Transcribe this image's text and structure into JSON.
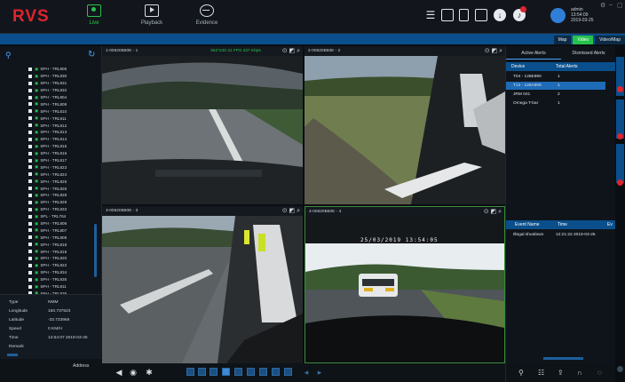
{
  "app": {
    "logo": "RVS"
  },
  "nav": [
    {
      "label": "Live",
      "icon": "live-monitor-icon",
      "active": true
    },
    {
      "label": "Playback",
      "icon": "playback-icon",
      "active": false
    },
    {
      "label": "Evidence",
      "icon": "evidence-icon",
      "active": false
    }
  ],
  "user": {
    "name": "admin",
    "time": "13:54:09",
    "date": "2019-03-25"
  },
  "right_tabs": [
    {
      "label": "Map",
      "active": false
    },
    {
      "label": "Video",
      "active": true
    },
    {
      "label": "Video/Map",
      "active": false
    }
  ],
  "devices": [
    "SPH - TRL805",
    "SPH - TRL830",
    "SPH - TRL831",
    "SPH - TRL832",
    "SPH - TRL804",
    "SPH - TRL809",
    "SPH - TRL810",
    "SPH - TRL811",
    "SPH - TRL812",
    "SPH - TRL813",
    "SPH - TRL814",
    "SPH - TRL815",
    "SPH - TRL816",
    "SPH - TRL817",
    "SPH - TRL823",
    "SPH - TRL824",
    "SPH - TRL825",
    "SPH - TRL826",
    "SPH - TRL828",
    "SPH - TRL829",
    "SPH - TRL833",
    "SPL - TRL764",
    "SPH - TRL806",
    "SPH - TRL807",
    "SPH - TRL808",
    "SPH - TRL818",
    "SPH - TRL819",
    "SPH - TRL820",
    "SPH - TRL822",
    "SPH - TRL834",
    "SPH - TRL835",
    "SPH - TRL811",
    "SPH - TRL836"
  ],
  "gps": {
    "type_label": "Type",
    "type": "NMM",
    "longitude_label": "Longitude",
    "longitude": "150.737523",
    "latitude_label": "Latitude",
    "latitude": "-33.733968",
    "speed_label": "Speed",
    "speed": "0 KM/H",
    "time_label": "Time",
    "time": "13:54:07 2019-03-25",
    "remark_label": "Remark",
    "remark": "",
    "address_label": "Address"
  },
  "videos": [
    {
      "title": "1-00620B60E - 1",
      "stats": "352*240   31 FPS   337 Kbps"
    },
    {
      "title": "2-00620B60E - 2",
      "stats": ""
    },
    {
      "title": "3-00620B60E - 3",
      "stats": ""
    },
    {
      "title": "4-00620B60E - 4",
      "stats": ""
    }
  ],
  "video4_overlay": "25/03/2019 13:54:05",
  "alerts": {
    "tab_active": "Active Alerts",
    "tab_dismissed": "Dismissed Alerts",
    "col_device": "Device",
    "col_total": "Total Alerts",
    "rows": [
      {
        "device": "T04 - 126E890",
        "total": "1"
      },
      {
        "device": "T12 - 126A809",
        "total": "1",
        "selected": true
      },
      {
        "device": "JRM 041",
        "total": "2"
      },
      {
        "device": "Omega T-bar",
        "total": "1"
      }
    ]
  },
  "events": {
    "col_name": "Event Name",
    "col_time": "Time",
    "col_extra": "Ev",
    "rows": [
      {
        "name": "Illegal shutdown",
        "time": "12:21:22 2019-03-25"
      }
    ]
  }
}
